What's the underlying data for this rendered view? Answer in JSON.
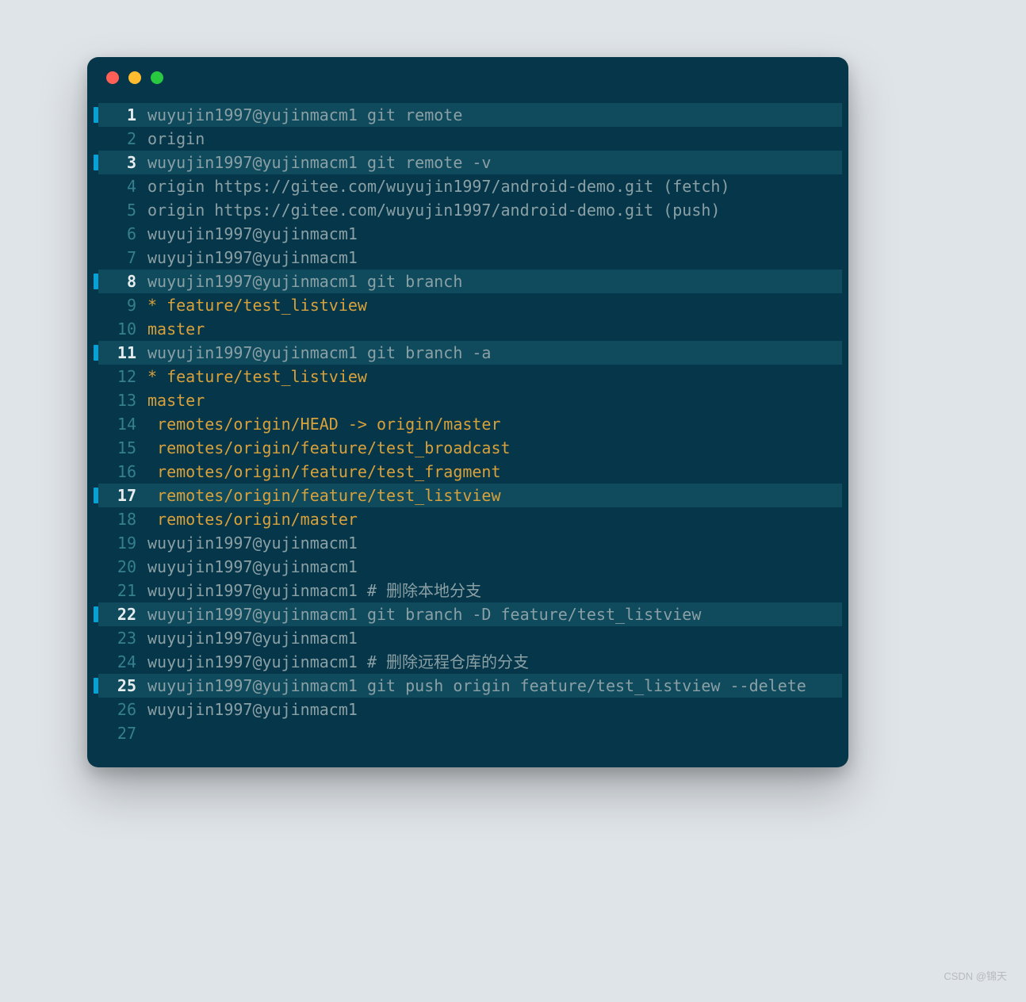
{
  "watermark": "CSDN @锦天",
  "window": {
    "traffic": [
      "close",
      "minimize",
      "zoom"
    ]
  },
  "lines": [
    {
      "n": 1,
      "hl": true,
      "mark": true,
      "seg": [
        [
          "gray",
          "wuyujin1997@yujinmacm1 git remote"
        ]
      ]
    },
    {
      "n": 2,
      "hl": false,
      "mark": false,
      "seg": [
        [
          "gray",
          "origin"
        ]
      ]
    },
    {
      "n": 3,
      "hl": true,
      "mark": true,
      "seg": [
        [
          "gray",
          "wuyujin1997@yujinmacm1 git remote -v"
        ]
      ]
    },
    {
      "n": 4,
      "hl": false,
      "mark": false,
      "seg": [
        [
          "gray",
          "origin https://gitee.com/wuyujin1997/android-demo.git (fetch)"
        ]
      ]
    },
    {
      "n": 5,
      "hl": false,
      "mark": false,
      "seg": [
        [
          "gray",
          "origin https://gitee.com/wuyujin1997/android-demo.git (push)"
        ]
      ]
    },
    {
      "n": 6,
      "hl": false,
      "mark": false,
      "seg": [
        [
          "gray",
          "wuyujin1997@yujinmacm1"
        ]
      ]
    },
    {
      "n": 7,
      "hl": false,
      "mark": false,
      "seg": [
        [
          "gray",
          "wuyujin1997@yujinmacm1"
        ]
      ]
    },
    {
      "n": 8,
      "hl": true,
      "mark": true,
      "seg": [
        [
          "gray",
          "wuyujin1997@yujinmacm1 git branch"
        ]
      ]
    },
    {
      "n": 9,
      "hl": false,
      "mark": false,
      "seg": [
        [
          "yellow",
          "* feature/test_listview"
        ]
      ]
    },
    {
      "n": 10,
      "hl": false,
      "mark": false,
      "seg": [
        [
          "yellow",
          "master"
        ]
      ]
    },
    {
      "n": 11,
      "hl": true,
      "mark": true,
      "seg": [
        [
          "gray",
          "wuyujin1997@yujinmacm1 git branch -a"
        ]
      ]
    },
    {
      "n": 12,
      "hl": false,
      "mark": false,
      "seg": [
        [
          "yellow",
          "* feature/test_listview"
        ]
      ]
    },
    {
      "n": 13,
      "hl": false,
      "mark": false,
      "seg": [
        [
          "yellow",
          "master"
        ]
      ]
    },
    {
      "n": 14,
      "hl": false,
      "mark": false,
      "seg": [
        [
          "yellow",
          " remotes/origin/HEAD -> origin/master"
        ]
      ]
    },
    {
      "n": 15,
      "hl": false,
      "mark": false,
      "seg": [
        [
          "yellow",
          " remotes/origin/feature/test_broadcast"
        ]
      ]
    },
    {
      "n": 16,
      "hl": false,
      "mark": false,
      "seg": [
        [
          "yellow",
          " remotes/origin/feature/test_fragment"
        ]
      ]
    },
    {
      "n": 17,
      "hl": true,
      "mark": true,
      "seg": [
        [
          "yellow",
          " remotes/origin/feature/test_listview"
        ]
      ]
    },
    {
      "n": 18,
      "hl": false,
      "mark": false,
      "seg": [
        [
          "yellow",
          " remotes/origin/master"
        ]
      ]
    },
    {
      "n": 19,
      "hl": false,
      "mark": false,
      "seg": [
        [
          "gray",
          "wuyujin1997@yujinmacm1"
        ]
      ]
    },
    {
      "n": 20,
      "hl": false,
      "mark": false,
      "seg": [
        [
          "gray",
          "wuyujin1997@yujinmacm1"
        ]
      ]
    },
    {
      "n": 21,
      "hl": false,
      "mark": false,
      "seg": [
        [
          "gray",
          "wuyujin1997@yujinmacm1 # 删除本地分支"
        ]
      ]
    },
    {
      "n": 22,
      "hl": true,
      "mark": true,
      "seg": [
        [
          "gray",
          "wuyujin1997@yujinmacm1 git branch -D feature/test_listview"
        ]
      ]
    },
    {
      "n": 23,
      "hl": false,
      "mark": false,
      "seg": [
        [
          "gray",
          "wuyujin1997@yujinmacm1"
        ]
      ]
    },
    {
      "n": 24,
      "hl": false,
      "mark": false,
      "seg": [
        [
          "gray",
          "wuyujin1997@yujinmacm1 # 删除远程仓库的分支"
        ]
      ]
    },
    {
      "n": 25,
      "hl": true,
      "mark": true,
      "seg": [
        [
          "gray",
          "wuyujin1997@yujinmacm1 git push origin feature/test_listview --delete"
        ]
      ]
    },
    {
      "n": 26,
      "hl": false,
      "mark": false,
      "seg": [
        [
          "gray",
          "wuyujin1997@yujinmacm1"
        ]
      ]
    },
    {
      "n": 27,
      "hl": false,
      "mark": false,
      "seg": [
        [
          "gray",
          ""
        ]
      ]
    }
  ]
}
